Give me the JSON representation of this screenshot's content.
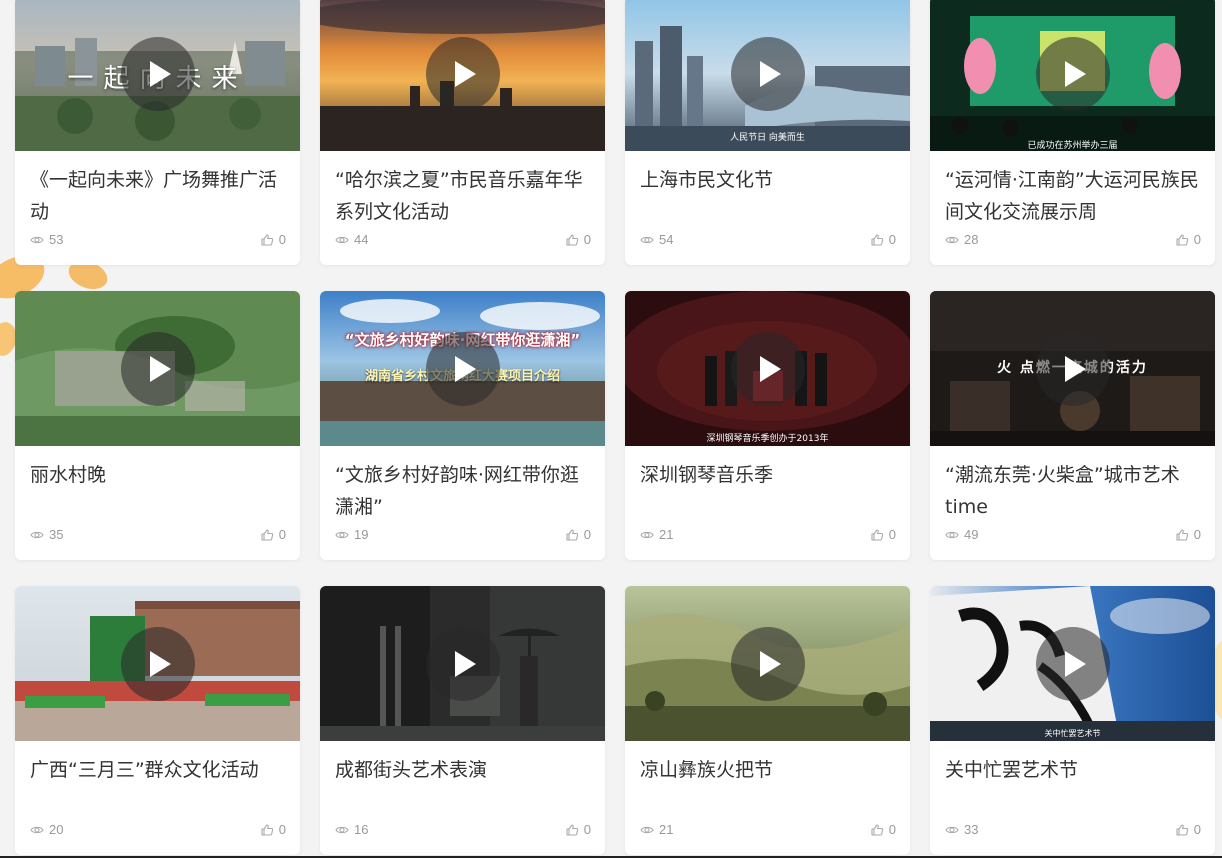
{
  "videos": [
    {
      "title": "《一起向未来》广场舞推广活动",
      "views": "53",
      "likes": "0",
      "overlay": "一起向未来",
      "caption": ""
    },
    {
      "title": "“哈尔滨之夏”市民音乐嘉年华系列文化活动",
      "views": "44",
      "likes": "0",
      "overlay": "",
      "caption": ""
    },
    {
      "title": "上海市民文化节",
      "views": "54",
      "likes": "0",
      "overlay": "",
      "caption": "人民节日  向美而生"
    },
    {
      "title": "“运河情·江南韵”大运河民族民间文化交流展示周",
      "views": "28",
      "likes": "0",
      "overlay": "",
      "caption": "已成功在苏州举办三届"
    },
    {
      "title": "丽水村晚",
      "views": "35",
      "likes": "0",
      "overlay": "",
      "caption": ""
    },
    {
      "title": "“文旅乡村好韵味·网红带你逛潇湘”",
      "views": "19",
      "likes": "0",
      "overlay": "“文旅乡村好韵味·网红带你逛潇湘”",
      "caption": "湖南省乡村文旅网红大赛项目介绍"
    },
    {
      "title": "深圳钢琴音乐季",
      "views": "21",
      "likes": "0",
      "overlay": "",
      "caption": "深圳钢琴音乐季创办于2013年"
    },
    {
      "title": "“潮流东莞·火柴盒”城市艺术time",
      "views": "49",
      "likes": "0",
      "overlay": "火  点燃一座城的活力",
      "caption": ""
    },
    {
      "title": "广西“三月三”群众文化活动",
      "views": "20",
      "likes": "0",
      "overlay": "",
      "caption": ""
    },
    {
      "title": "成都街头艺术表演",
      "views": "16",
      "likes": "0",
      "overlay": "",
      "caption": ""
    },
    {
      "title": "凉山彝族火把节",
      "views": "21",
      "likes": "0",
      "overlay": "",
      "caption": ""
    },
    {
      "title": "关中忙罢艺术节",
      "views": "33",
      "likes": "0",
      "overlay": "",
      "caption": "关中忙罢艺术节"
    }
  ],
  "icons": {
    "views": "eye-icon",
    "likes": "thumbs-up-icon",
    "play": "play-icon"
  },
  "colors": {
    "title": "#333333",
    "meta": "#999999",
    "card": "#ffffff",
    "background": "#f3f3f3"
  }
}
